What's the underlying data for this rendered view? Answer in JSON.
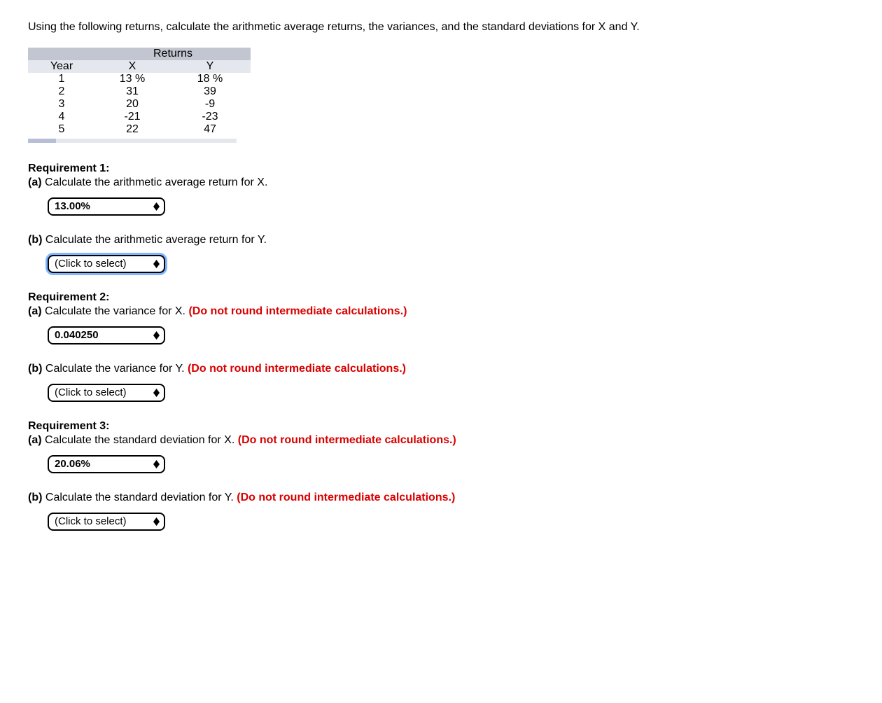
{
  "intro": "Using the following returns, calculate the arithmetic average returns, the variances, and the standard deviations for X and Y.",
  "table": {
    "super_header": "Returns",
    "headers": {
      "year": "Year",
      "x": "X",
      "y": "Y"
    },
    "rows": [
      {
        "year": "1",
        "x": "13 %",
        "y": "18 %"
      },
      {
        "year": "2",
        "x": "31",
        "y": "39"
      },
      {
        "year": "3",
        "x": "20",
        "y": "-9"
      },
      {
        "year": "4",
        "x": "-21",
        "y": "-23"
      },
      {
        "year": "5",
        "x": "22",
        "y": "47"
      }
    ]
  },
  "placeholder": "(Click to select)",
  "warn_text": "(Do not round intermediate calculations.)",
  "req1": {
    "title": "Requirement 1:",
    "a_label": "(a)",
    "a_text": " Calculate the arithmetic average return for X.",
    "a_value": "13.00%",
    "b_label": "(b)",
    "b_text": " Calculate the arithmetic average return for Y."
  },
  "req2": {
    "title": "Requirement 2:",
    "a_label": "(a)",
    "a_text": " Calculate the variance for X. ",
    "a_value": "0.040250",
    "b_label": "(b)",
    "b_text": " Calculate the variance for Y. "
  },
  "req3": {
    "title": "Requirement 3:",
    "a_label": "(a)",
    "a_text": " Calculate the standard deviation for X. ",
    "a_value": "20.06%",
    "b_label": "(b)",
    "b_text": " Calculate the standard deviation for Y. "
  }
}
